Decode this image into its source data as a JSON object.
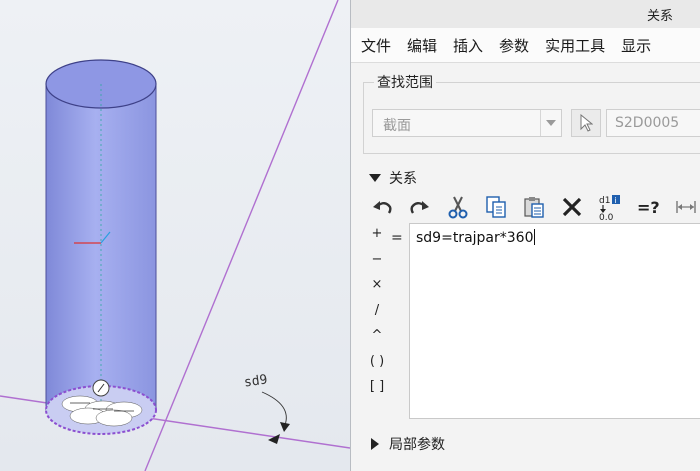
{
  "window": {
    "title": "关系"
  },
  "menu": {
    "items": [
      "文件",
      "编辑",
      "插入",
      "参数",
      "实用工具",
      "显示"
    ]
  },
  "find_scope": {
    "label": "查找范围",
    "scope_value": "截面",
    "part_value": "S2D0005"
  },
  "relations": {
    "label": "关系",
    "toolbar": [
      "undo-icon",
      "redo-icon",
      "cut-icon",
      "copy-icon",
      "paste-icon",
      "delete-icon",
      "evaluate-icon",
      "verify-icon",
      "units-icon"
    ],
    "operators": [
      "+",
      "−",
      "×",
      "/",
      "^",
      "( )",
      "[ ]"
    ],
    "equals": "=",
    "text": "sd9=trajpar*360"
  },
  "viewport": {
    "dimension_label": "sd9",
    "cylinder_color": "#9aa4e8",
    "line_color": "#b070d0"
  },
  "local_params": {
    "label": "局部参数"
  },
  "colors": {
    "accent": "#1f5fae",
    "delete": "#222222"
  }
}
